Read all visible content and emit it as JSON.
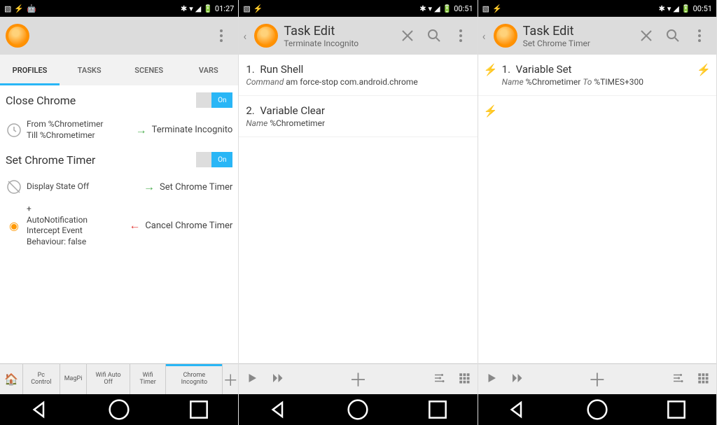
{
  "status": {
    "time1": "01:27",
    "time2": "00:51",
    "time3": "00:51"
  },
  "p1": {
    "tabs": [
      "PROFILES",
      "TASKS",
      "SCENES",
      "VARS"
    ],
    "profiles": [
      {
        "name": "Close Chrome",
        "on": "On",
        "conditions": [
          {
            "icon": "clock",
            "text": "From %Chrometimer\nTill %Chrometimer",
            "arrow": "green",
            "task": "Terminate Incognito"
          }
        ]
      },
      {
        "name": "Set Chrome Timer",
        "on": "On",
        "conditions": [
          {
            "icon": "circle",
            "text": "Display State Off",
            "arrow": "green",
            "task": "Set Chrome Timer"
          },
          {
            "icon": "app",
            "text": "+\nAutoNotification\nIntercept Event\nBehaviour: false",
            "arrow": "red",
            "task": "Cancel Chrome Timer"
          }
        ]
      }
    ],
    "projects": [
      "Pc Control",
      "MagPi",
      "Wifi Auto Off",
      "Wifi Timer",
      "Chrome Incognito"
    ]
  },
  "p2": {
    "title": "Task Edit",
    "subtitle": "Terminate Incognito",
    "actions": [
      {
        "num": "1.",
        "name": "Run Shell",
        "label": "Command",
        "val": "am force-stop com.android.chrome"
      },
      {
        "num": "2.",
        "name": "Variable Clear",
        "label": "Name",
        "val": "%Chrometimer"
      }
    ]
  },
  "p3": {
    "title": "Task Edit",
    "subtitle": "Set Chrome Timer",
    "actions": [
      {
        "num": "1.",
        "name": "Variable Set",
        "label": "Name",
        "val": "%Chrometimer",
        "label2": "To",
        "val2": "%TIMES+300",
        "flash": true
      }
    ]
  }
}
